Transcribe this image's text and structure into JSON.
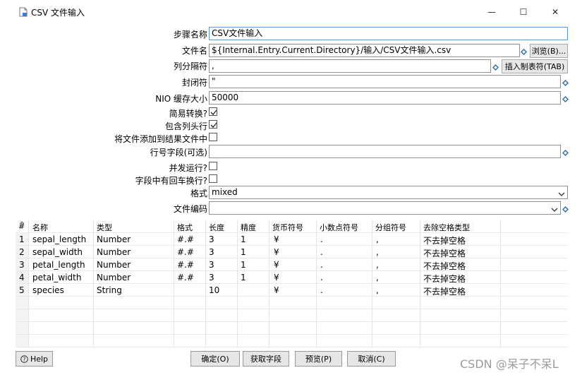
{
  "window": {
    "title": "CSV 文件输入",
    "minimize": "—",
    "maximize": "☐",
    "close": "✕"
  },
  "form": {
    "step_name_label": "步骤名称",
    "step_name_value": "CSV文件输入",
    "filename_label": "文件名",
    "filename_value": "${Internal.Entry.Current.Directory}/输入/CSV文件输入.csv",
    "browse_button": "浏览(B)...",
    "delimiter_label": "列分隔符",
    "delimiter_value": ",",
    "insert_tab_button": "插入制表符(TAB)",
    "enclosure_label": "封闭符",
    "enclosure_value": "\"",
    "nio_label": "NIO 缓存大小",
    "nio_value": "50000",
    "lazy_label": "简易转换?",
    "lazy_checked": true,
    "header_label": "包含列头行",
    "header_checked": true,
    "add_result_label": "将文件添加到结果文件中",
    "add_result_checked": false,
    "rownum_label": "行号字段(可选)",
    "rownum_value": "",
    "parallel_label": "并发运行?",
    "parallel_checked": false,
    "newline_label": "字段中有回车换行?",
    "newline_checked": false,
    "format_label": "格式",
    "format_value": "mixed",
    "encoding_label": "文件编码",
    "encoding_value": ""
  },
  "table": {
    "columns": [
      "#",
      "名称",
      "类型",
      "格式",
      "长度",
      "精度",
      "货币符号",
      "小数点符号",
      "分组符号",
      "去除空格类型"
    ],
    "rows": [
      [
        "1",
        "sepal_length",
        "Number",
        "#.#",
        "3",
        "1",
        "¥",
        ".",
        ",",
        "不去掉空格"
      ],
      [
        "2",
        "sepal_width",
        "Number",
        "#.#",
        "3",
        "1",
        "¥",
        ".",
        ",",
        "不去掉空格"
      ],
      [
        "3",
        "petal_length",
        "Number",
        "#.#",
        "3",
        "1",
        "¥",
        ".",
        ",",
        "不去掉空格"
      ],
      [
        "4",
        "petal_width",
        "Number",
        "#.#",
        "3",
        "1",
        "¥",
        ".",
        ",",
        "不去掉空格"
      ],
      [
        "5",
        "species",
        "String",
        "",
        "10",
        "",
        "¥",
        ".",
        ",",
        "不去掉空格"
      ]
    ]
  },
  "buttons": {
    "help": "Help",
    "ok": "确定(O)",
    "get_fields": "获取字段",
    "preview": "预览(P)",
    "cancel": "取消(C)"
  },
  "watermark": "CSDN @呆子不呆L",
  "colors": {
    "accent": "#5b9bd5",
    "var_icon": "#2e6da4"
  }
}
